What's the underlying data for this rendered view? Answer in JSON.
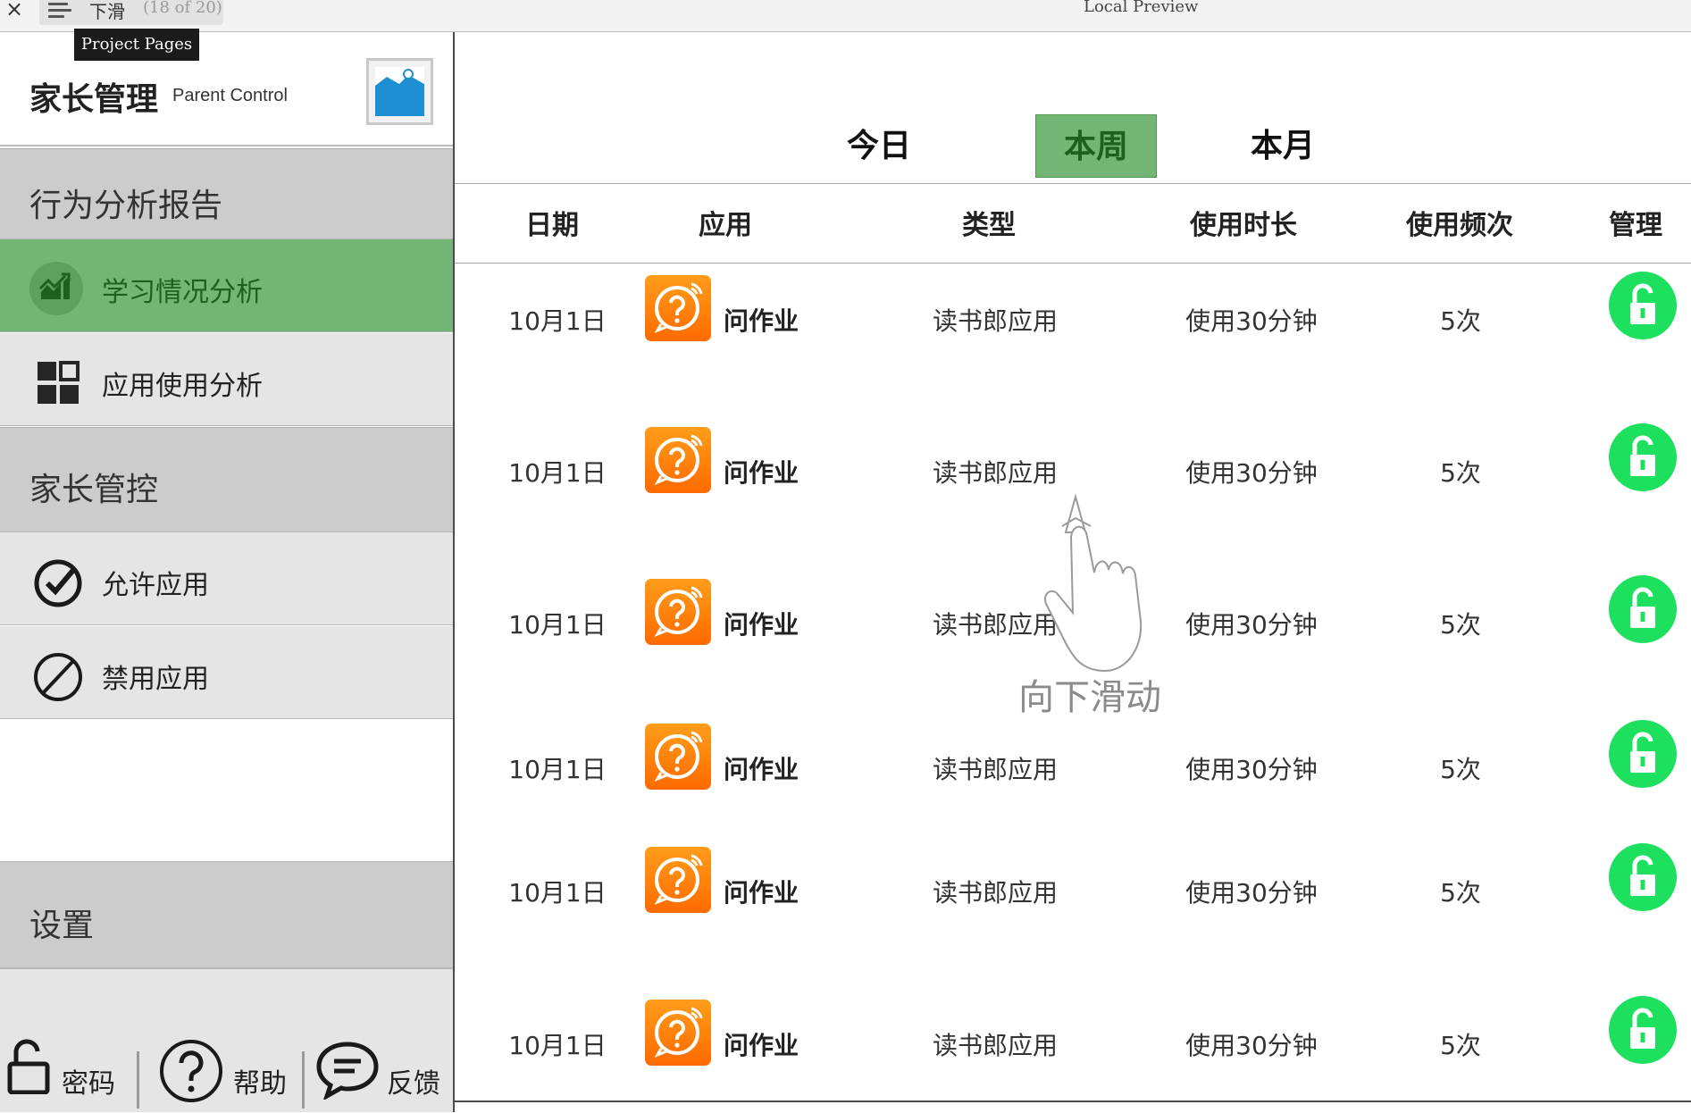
{
  "window": {
    "close_glyph": "×",
    "page_name": "下滑",
    "page_counter": "(18 of 20)",
    "title": "Local Preview",
    "tooltip": "Project Pages"
  },
  "brand": {
    "title": "家长管理",
    "subtitle": "Parent Control"
  },
  "sidebar": {
    "behavior_header": "行为分析报告",
    "study_analysis": "学习情况分析",
    "app_usage_analysis": "应用使用分析",
    "parental_header": "家长管控",
    "allow_apps": "允许应用",
    "ban_apps": "禁用应用",
    "settings_header": "设置",
    "footer": {
      "password": "密码",
      "help": "帮助",
      "feedback": "反馈"
    }
  },
  "period_tabs": {
    "today": "今日",
    "week": "本周",
    "month": "本月",
    "selected": "本周"
  },
  "table": {
    "headers": {
      "date": "日期",
      "app": "应用",
      "type": "类型",
      "duration": "使用时长",
      "frequency": "使用频次",
      "manage": "管理"
    },
    "rows": [
      {
        "date": "10月1日",
        "app": "问作业",
        "type": "读书郎应用",
        "duration": "使用30分钟",
        "frequency": "5次"
      },
      {
        "date": "10月1日",
        "app": "问作业",
        "type": "读书郎应用",
        "duration": "使用30分钟",
        "frequency": "5次"
      },
      {
        "date": "10月1日",
        "app": "问作业",
        "type": "读书郎应用",
        "duration": "使用30分钟",
        "frequency": "5次"
      },
      {
        "date": "10月1日",
        "app": "问作业",
        "type": "读书郎应用",
        "duration": "使用30分钟",
        "frequency": "5次"
      },
      {
        "date": "10月1日",
        "app": "问作业",
        "type": "读书郎应用",
        "duration": "使用30分钟",
        "frequency": "5次"
      },
      {
        "date": "10月1日",
        "app": "问作业",
        "type": "读书郎应用",
        "duration": "使用30分钟",
        "frequency": "5次"
      }
    ]
  },
  "gesture_hint": "向下滑动",
  "colors": {
    "active_green": "#73b574",
    "active_text": "#1f5f20",
    "unlock_green": "#1ee05f",
    "app_orange": "#ff7a00",
    "header_grey": "#cccccc",
    "item_grey": "#e5e5e5"
  },
  "icons": {
    "study_analysis": "trend-chart-icon",
    "app_usage_analysis": "grid-icon",
    "allow_apps": "check-circle-icon",
    "ban_apps": "ban-icon",
    "password": "unlock-icon",
    "help": "question-icon",
    "feedback": "chat-bubble-icon",
    "app": "question-bubble-app-icon",
    "manage": "unlock-icon",
    "brand_logo": "image-placeholder-icon"
  }
}
